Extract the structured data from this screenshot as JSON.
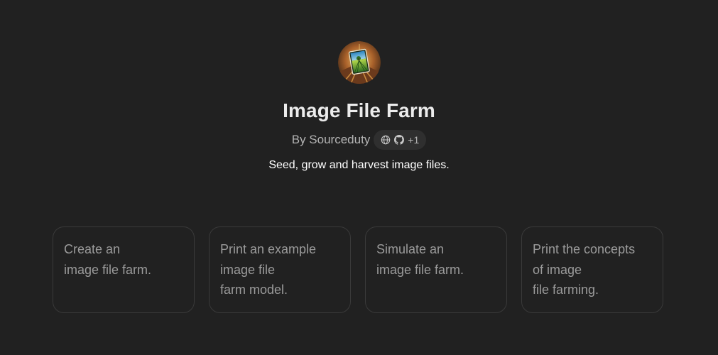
{
  "gpt": {
    "name": "Image File Farm",
    "byline": "By Sourceduty",
    "badge_extra": "+1",
    "description": "Seed, grow and harvest image files.",
    "badge_icons": [
      "globe-icon",
      "github-icon"
    ]
  },
  "starters": [
    {
      "lines": [
        "Create an",
        "image file farm."
      ]
    },
    {
      "lines": [
        "Print an example",
        "image file",
        "farm model."
      ]
    },
    {
      "lines": [
        "Simulate an",
        "image file farm."
      ]
    },
    {
      "lines": [
        "Print the concepts",
        "of image",
        "file farming."
      ]
    }
  ],
  "colors": {
    "background": "#212121",
    "card_border": "#3a3a3a",
    "badge_background": "#2f2f2f",
    "title": "#ececec",
    "muted": "#b4b4b4",
    "card_text": "#9b9b9b"
  }
}
